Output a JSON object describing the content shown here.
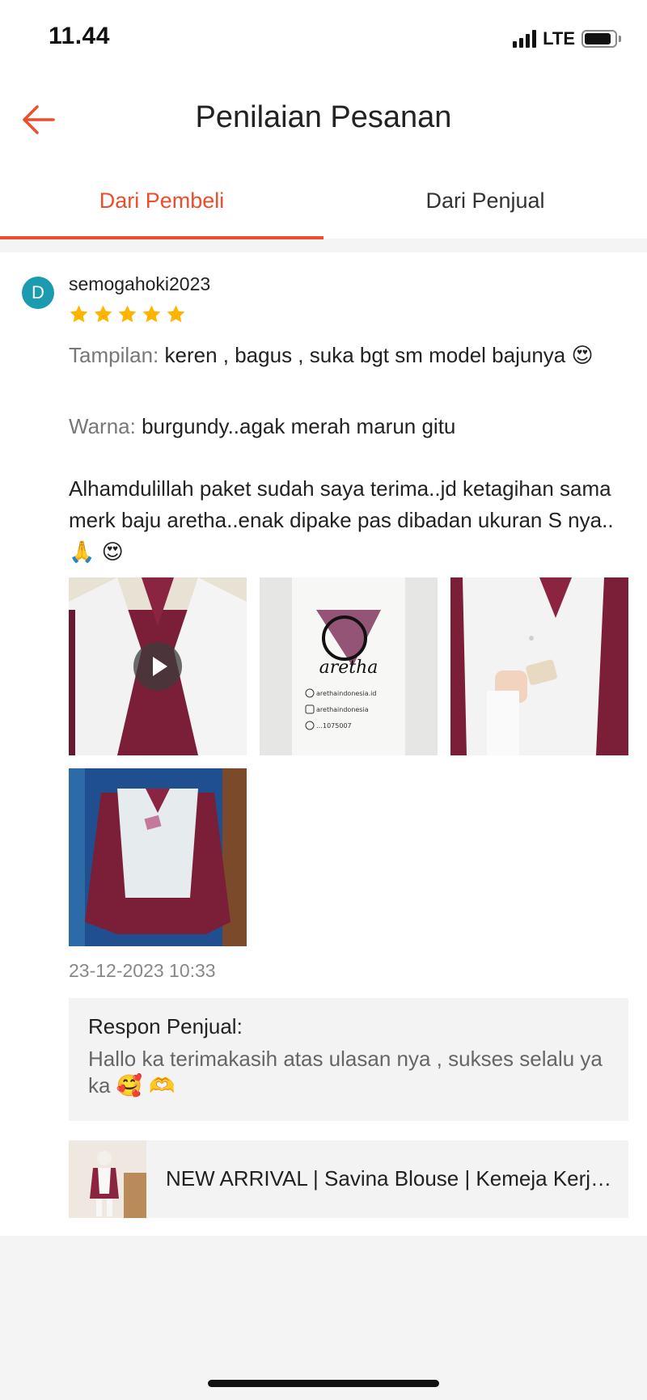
{
  "status_bar": {
    "time": "11.44",
    "network": "LTE",
    "signal_bars": 4,
    "battery_level": 0.9
  },
  "header": {
    "title": "Penilaian Pesanan",
    "back_icon": "arrow-left-icon"
  },
  "tabs": [
    {
      "label": "Dari Pembeli",
      "active": true
    },
    {
      "label": "Dari Penjual",
      "active": false
    }
  ],
  "colors": {
    "accent": "#ee4d2d",
    "avatar": "#1a9bb0",
    "star": "#ffb400"
  },
  "review": {
    "avatar_letter": "D",
    "username": "semogahoki2023",
    "rating": 5,
    "tampilan_label": "Tampilan:",
    "tampilan_text": "keren , bagus , suka bgt sm model bajunya",
    "tampilan_emoji": "😍",
    "warna_label": "Warna:",
    "warna_text": "burgundy..agak merah marun gitu",
    "body_text": "Alhamdulillah paket sudah saya terima..jd ketagihan sama merk baju aretha..enak dipake pas dibadan ukuran S nya..",
    "body_emoji": "🙏 😍",
    "media": [
      {
        "type": "video",
        "icon": "play-icon"
      },
      {
        "type": "photo",
        "package_brand": "aretha",
        "package_lines": [
          "arethaindonesia.id",
          "arethaindonesia",
          "…1075007"
        ]
      },
      {
        "type": "photo"
      },
      {
        "type": "photo"
      }
    ],
    "timestamp": "23-12-2023 10:33",
    "seller_response_label": "Respon Penjual:",
    "seller_response_text": "Hallo ka terimakasih atas ulasan nya , sukses selalu ya ka",
    "seller_response_emoji": "🥰 🫶"
  },
  "product": {
    "name": "NEW ARRIVAL | Savina Blouse | Kemeja Kerja Wanita"
  }
}
